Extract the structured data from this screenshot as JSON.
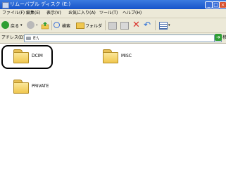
{
  "window": {
    "title": "リムーバブル ディスク (E:)"
  },
  "menubar": {
    "items": [
      "ファイル(F)",
      "編集(E)",
      "表示(V)",
      "お気に入り(A)",
      "ツール(T)",
      "ヘルプ(H)"
    ]
  },
  "toolbar": {
    "back_label": "戻る",
    "search_label": "検索",
    "folders_label": "フォルダ"
  },
  "addressbar": {
    "label": "アドレス(D)",
    "value": "E:\\",
    "go_label": "移動"
  },
  "items": [
    {
      "label": "DCIM",
      "highlighted": true
    },
    {
      "label": "MISC"
    },
    {
      "label": "PRIVATE"
    }
  ]
}
